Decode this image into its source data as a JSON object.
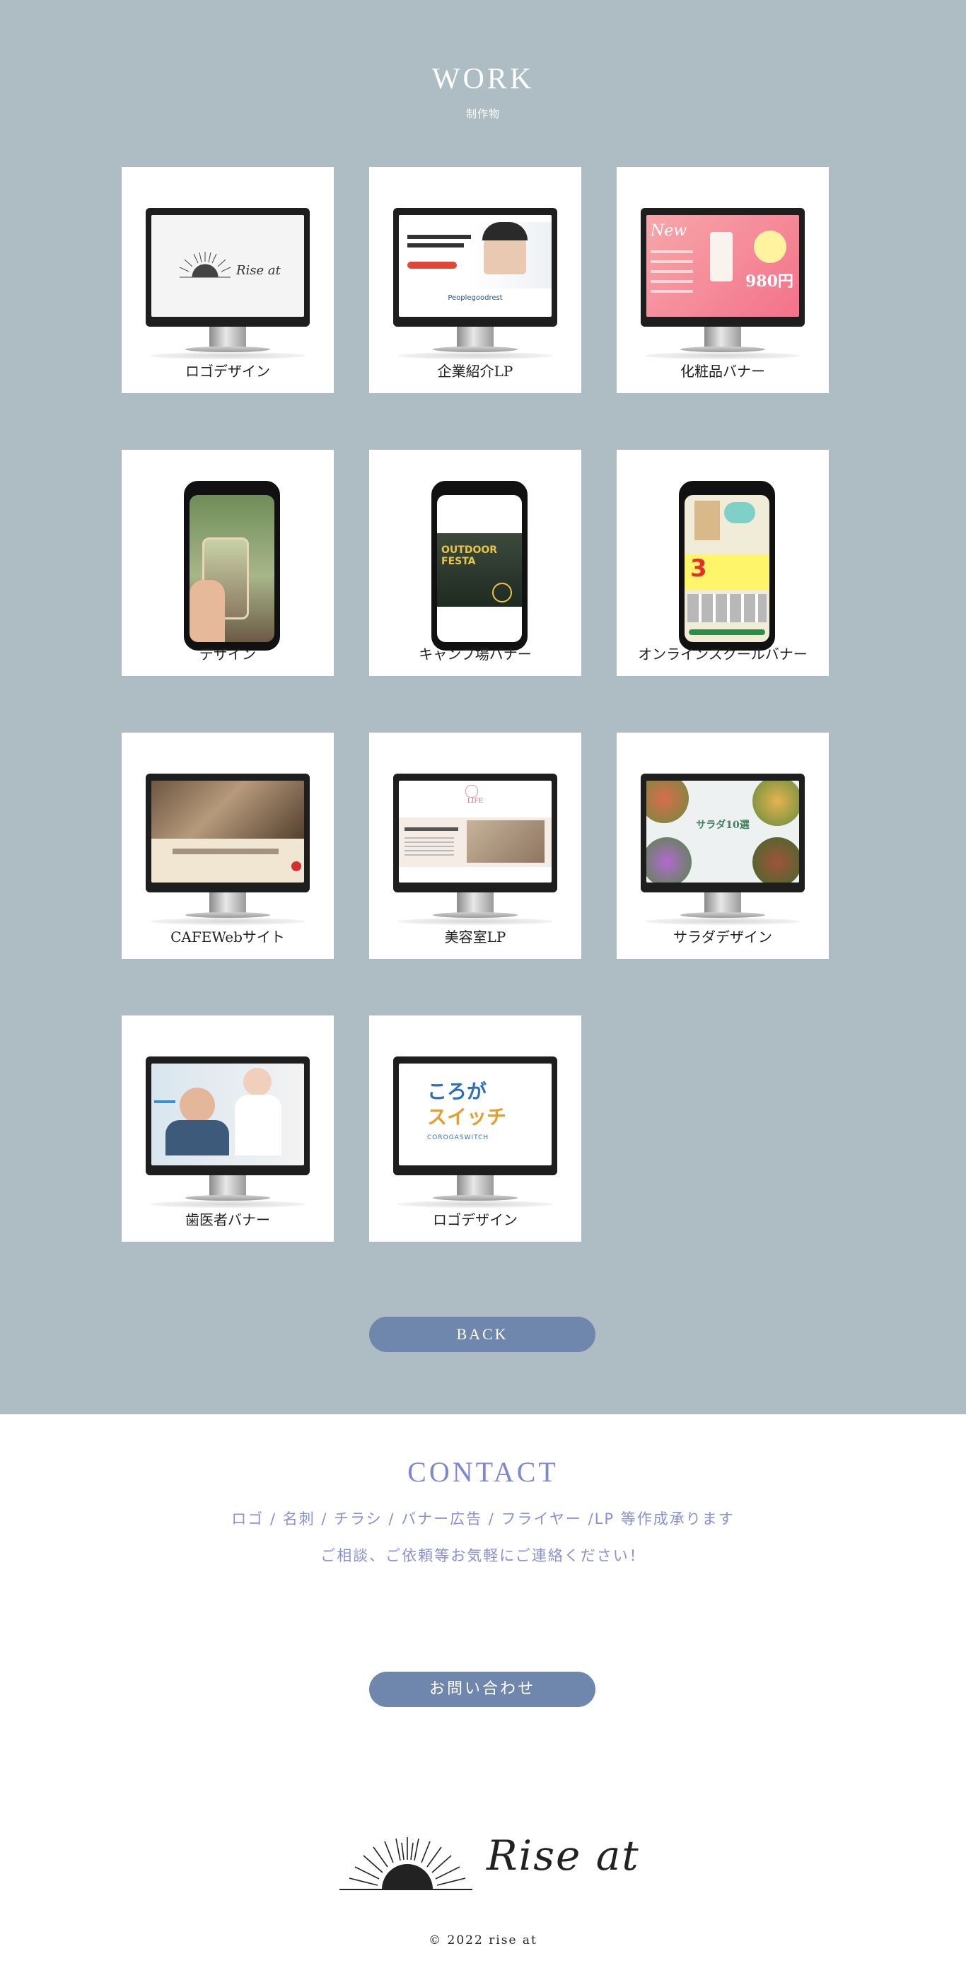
{
  "work": {
    "title": "WORK",
    "subtitle": "制作物",
    "back_label": "BACK",
    "items": [
      {
        "caption": "ロゴデザイン",
        "device": "monitor",
        "thumb": "logo"
      },
      {
        "caption": "企業紹介LP",
        "device": "monitor",
        "thumb": "corporate-lp"
      },
      {
        "caption": "化粧品バナー",
        "device": "monitor",
        "thumb": "cosmetics"
      },
      {
        "caption": "デザイン",
        "device": "phone",
        "thumb": "photo"
      },
      {
        "caption": "キャンプ場バナー",
        "device": "phone",
        "thumb": "outdoor"
      },
      {
        "caption": "オンラインスクールバナー",
        "device": "phone",
        "thumb": "school"
      },
      {
        "caption": "CAFEWebサイト",
        "device": "monitor",
        "thumb": "cafe"
      },
      {
        "caption": "美容室LP",
        "device": "monitor",
        "thumb": "salon"
      },
      {
        "caption": "サラダデザイン",
        "device": "monitor",
        "thumb": "salad"
      },
      {
        "caption": "歯医者バナー",
        "device": "monitor",
        "thumb": "dentist"
      },
      {
        "caption": "ロゴデザイン",
        "device": "monitor",
        "thumb": "switch"
      }
    ],
    "thumb_text": {
      "logo": "Rise at",
      "corporate_brand": "Peoplegoodrest",
      "cosmetics_price": "980円",
      "cosmetics_new": "New",
      "outdoor": "OUTDOOR FESTA",
      "school_big": "3",
      "salad": "サラダ10選",
      "salon": "LIFE",
      "switch_line1": "ころが",
      "switch_line2": "スイッチ",
      "switch_sub": "COROGASWITCH"
    }
  },
  "contact": {
    "title": "CONTACT",
    "line1": "ロゴ / 名刺 / チラシ / バナー広告 / フライヤー /LP 等作成承ります",
    "line2": "ご相談、ご依頼等お気軽にご連絡ください！",
    "button_label": "お問い合わせ"
  },
  "footer": {
    "logo_text": "Rise at",
    "copyright": "© 2022 rise at"
  },
  "colors": {
    "work_bg": "#aebdc4",
    "button": "#6f86ad",
    "contact_accent": "#7f87d3"
  }
}
